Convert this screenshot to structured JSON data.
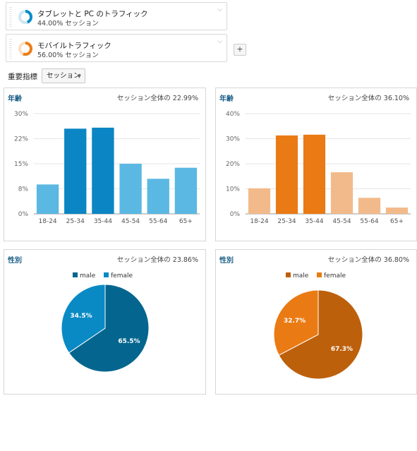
{
  "segments": [
    {
      "name": "タブレットと PC のトラフィック",
      "sub": "44.00% セッション",
      "color": "#058dc7",
      "ring_fraction": 0.44
    },
    {
      "name": "モバイルトラフィック",
      "sub": "56.00% セッション",
      "color": "#ed7e17",
      "ring_fraction": 0.56
    }
  ],
  "add_label": "+",
  "metric": {
    "label": "重要指標",
    "value": "セッション"
  },
  "colors": {
    "blue_dark": "#0b85c4",
    "blue_light": "#5bb8e3",
    "orange_dark": "#ea7b14",
    "orange_light": "#f2ba8a",
    "male_blue": "#04668f",
    "female_blue": "#0a8ac4",
    "male_orange": "#bd600c",
    "female_orange": "#ea7b14"
  },
  "panels": {
    "age_left": {
      "title": "年齢",
      "total": "セッション全体の 22.99%"
    },
    "age_right": {
      "title": "年齢",
      "total": "セッション全体の 36.10%"
    },
    "gender_left": {
      "title": "性別",
      "total": "セッション全体の 23.86%"
    },
    "gender_right": {
      "title": "性別",
      "total": "セッション全体の 36.80%"
    }
  },
  "chart_data": [
    {
      "type": "bar",
      "title": "年齢",
      "categories": [
        "18-24",
        "25-34",
        "35-44",
        "45-54",
        "55-64",
        "65+"
      ],
      "values": [
        8.8,
        25.5,
        25.8,
        15.0,
        10.5,
        13.8
      ],
      "yticks": [
        "0%",
        "8%",
        "15%",
        "22%",
        "30%"
      ],
      "ylim": [
        0,
        30
      ],
      "grid": true
    },
    {
      "type": "bar",
      "title": "年齢",
      "categories": [
        "18-24",
        "25-34",
        "35-44",
        "45-54",
        "55-64",
        "65+"
      ],
      "values": [
        10.2,
        31.3,
        31.6,
        16.6,
        6.4,
        2.5
      ],
      "yticks": [
        "0%",
        "10%",
        "20%",
        "30%",
        "40%"
      ],
      "ylim": [
        0,
        40
      ],
      "grid": true
    },
    {
      "type": "pie",
      "title": "性別",
      "legend": [
        "male",
        "female"
      ],
      "values": [
        65.5,
        34.5
      ],
      "labels": [
        "65.5%",
        "34.5%"
      ],
      "legend_position": "top"
    },
    {
      "type": "pie",
      "title": "性別",
      "legend": [
        "male",
        "female"
      ],
      "values": [
        67.3,
        32.7
      ],
      "labels": [
        "67.3%",
        "32.7%"
      ],
      "legend_position": "top"
    }
  ]
}
